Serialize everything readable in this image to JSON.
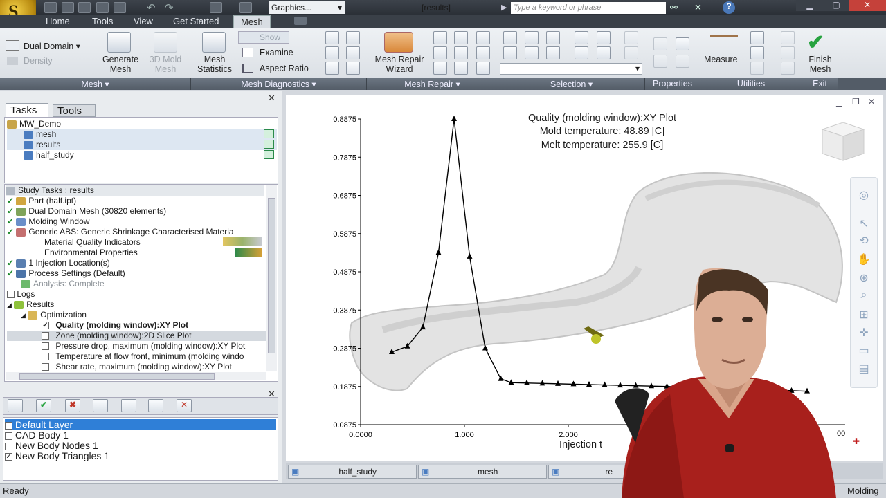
{
  "app": {
    "logo_text": "S",
    "logo_sub": "MFI",
    "workspace": "Graphics...",
    "doc_title": "[results]",
    "search_placeholder": "Type a keyword or phrase"
  },
  "ribbon_tabs": [
    "Home",
    "Tools",
    "View",
    "Get Started",
    "Mesh"
  ],
  "ribbon": {
    "mesh_group": {
      "dual_domain": "Dual Domain",
      "density": "Density",
      "generate_mesh": [
        "Generate",
        "Mesh"
      ],
      "mold_mesh": [
        "3D Mold",
        "Mesh"
      ]
    },
    "diagnostics_group": {
      "mesh_statistics": [
        "Mesh",
        "Statistics"
      ],
      "show": "Show",
      "examine": "Examine",
      "aspect_ratio": "Aspect Ratio"
    },
    "repair_group": {
      "wizard": [
        "Mesh Repair",
        "Wizard"
      ]
    },
    "utilities_group": {
      "measure": "Measure",
      "finish_mesh": [
        "Finish",
        "Mesh"
      ]
    },
    "group_labels": {
      "mesh": "Mesh",
      "diagnostics": "Mesh Diagnostics",
      "repair": "Mesh Repair",
      "selection": "Selection",
      "properties": "Properties",
      "utilities": "Utilities",
      "exit": "Exit"
    }
  },
  "left_panel": {
    "tabs": [
      "Tasks",
      "Tools"
    ],
    "project": {
      "name": "MW_Demo",
      "studies": [
        "mesh",
        "results",
        "half_study"
      ]
    },
    "study_header": "Study Tasks : results",
    "study_tasks": [
      "Part (half.ipt)",
      "Dual Domain Mesh (30820 elements)",
      "Molding Window",
      "Generic ABS: Generic Shrinkage Characterised Materia",
      "Material Quality Indicators",
      "Environmental Properties",
      "1 Injection Location(s)",
      "Process Settings (Default)",
      "Analysis: Complete",
      "Logs",
      "Results",
      "Optimization",
      "Quality (molding window):XY Plot",
      "Zone (molding window):2D Slice Plot",
      "Pressure drop, maximum (molding window):XY Plot",
      "Temperature at flow front, minimum (molding windo",
      "Shear rate, maximum (molding window):XY Plot"
    ],
    "layers": [
      "Default Layer",
      "CAD Body 1",
      "New Body Nodes 1",
      "New Body Triangles 1"
    ]
  },
  "plot": {
    "title": "Quality (molding window):XY Plot",
    "subtitle1": "Mold temperature: 48.89 [C]",
    "subtitle2": "Melt temperature: 255.9 [C]",
    "xlabel": "Injection t",
    "x_end_label": "00"
  },
  "chart_data": {
    "type": "line",
    "title": "Quality (molding window):XY Plot",
    "xlabel": "Injection t",
    "ylabel": "",
    "ylim": [
      0.0875,
      0.8875
    ],
    "xlim": [
      0.0,
      5.0
    ],
    "yticks": [
      "0.8875",
      "0.7875",
      "0.6875",
      "0.5875",
      "0.4875",
      "0.3875",
      "0.2875",
      "0.1875",
      "0.0875"
    ],
    "xticks": [
      "0.0000",
      "1.000",
      "2.000",
      "3.000",
      "4.000"
    ],
    "series": [
      {
        "x": [
          0.3,
          0.45,
          0.6,
          0.75,
          0.9,
          1.05,
          1.2,
          1.35,
          1.45,
          1.6,
          1.75,
          1.9,
          2.05,
          2.2,
          2.35,
          2.5,
          2.65,
          2.8,
          2.95,
          3.1,
          3.25,
          3.4,
          3.55,
          3.7,
          3.85,
          4.0,
          4.15,
          4.3
        ],
        "y": [
          0.2775,
          0.2925,
          0.3425,
          0.5375,
          0.8875,
          0.5275,
          0.2875,
          0.2075,
          0.1975,
          0.1965,
          0.1955,
          0.1945,
          0.1935,
          0.1925,
          0.1915,
          0.1905,
          0.1895,
          0.1885,
          0.1875,
          0.1865,
          0.1855,
          0.184,
          0.1825,
          0.181,
          0.1795,
          0.178,
          0.1765,
          0.175
        ]
      }
    ]
  },
  "doc_tabs": [
    "half_study",
    "mesh",
    "re"
  ],
  "status": {
    "left": "Ready",
    "right": "Molding"
  }
}
